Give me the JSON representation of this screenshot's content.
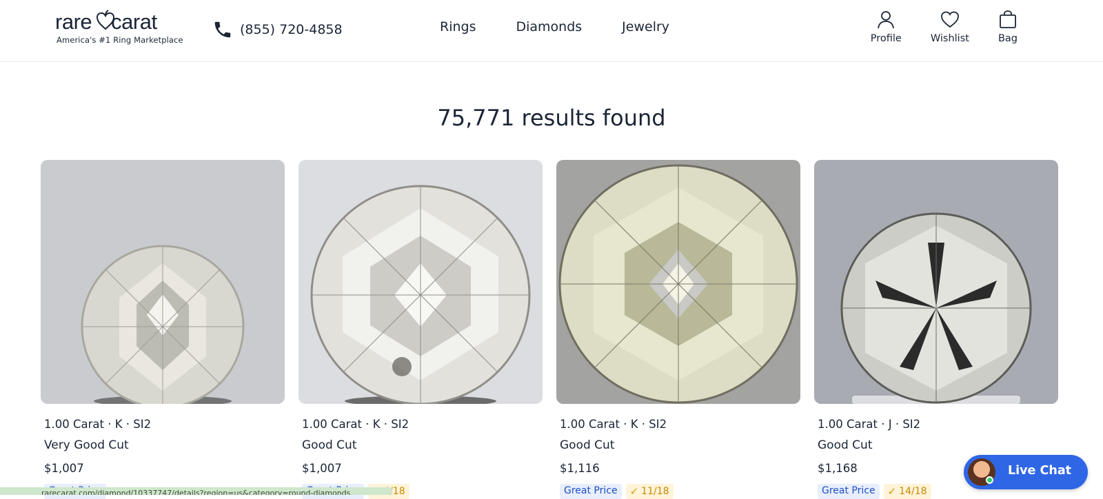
{
  "header": {
    "logo_word_left": "rare",
    "logo_word_right": "carat",
    "logo_tagline": "America's #1 Ring Marketplace",
    "phone": "(855) 720-4858",
    "nav": [
      "Rings",
      "Diamonds",
      "Jewelry"
    ],
    "actions": {
      "profile": "Profile",
      "wishlist": "Wishlist",
      "bag": "Bag"
    }
  },
  "results": {
    "count_text": "75,771 results found"
  },
  "products": [
    {
      "title": "1.00 Carat · K · SI2",
      "cut": "Very Good Cut",
      "price": "$1,007",
      "price_badge": "Great Price",
      "score": ""
    },
    {
      "title": "1.00 Carat · K · SI2",
      "cut": "Good Cut",
      "price": "$1,007",
      "price_badge": "Great Price",
      "score": "4/18"
    },
    {
      "title": "1.00 Carat · K · SI2",
      "cut": "Good Cut",
      "price": "$1,116",
      "price_badge": "Great Price",
      "score": "11/18"
    },
    {
      "title": "1.00 Carat · J · SI2",
      "cut": "Good Cut",
      "price": "$1,168",
      "price_badge": "Great Price",
      "score": "14/18"
    }
  ],
  "status_bar": {
    "url_text": "rarecarat.com/diamond/10337747/details?region=us&category=round-diamonds"
  },
  "live_chat": {
    "label": "Live Chat"
  },
  "colors": {
    "text_primary": "#1b2536",
    "accent_blue": "#2f66e6",
    "price_badge_text": "#1d4ec4",
    "score_badge_text": "#c98a00",
    "status_green": "#cfe7cc"
  }
}
